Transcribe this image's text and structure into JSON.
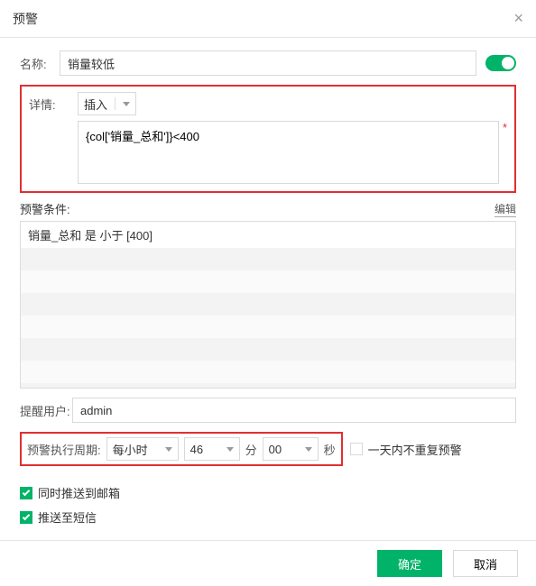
{
  "dialog": {
    "title": "预警",
    "close": "×"
  },
  "name": {
    "label": "名称:",
    "value": "销量较低"
  },
  "detail": {
    "label": "详情:",
    "insert_label": "插入",
    "value": "{col['销量_总和']}<400"
  },
  "conditions": {
    "label": "预警条件:",
    "edit": "编辑",
    "item0": "销量_总和 是 小于 [400]"
  },
  "remind": {
    "label": "提醒用户:",
    "value": "admin"
  },
  "period": {
    "label": "预警执行周期:",
    "unit_value": "每小时",
    "minute_value": "46",
    "minute_label": "分",
    "second_value": "00",
    "second_label": "秒"
  },
  "norepeat": {
    "label": "一天内不重复预警"
  },
  "push_email": {
    "label": "同时推送到邮箱"
  },
  "push_sms": {
    "label": "推送至短信"
  },
  "footer": {
    "ok": "确定",
    "cancel": "取消"
  }
}
